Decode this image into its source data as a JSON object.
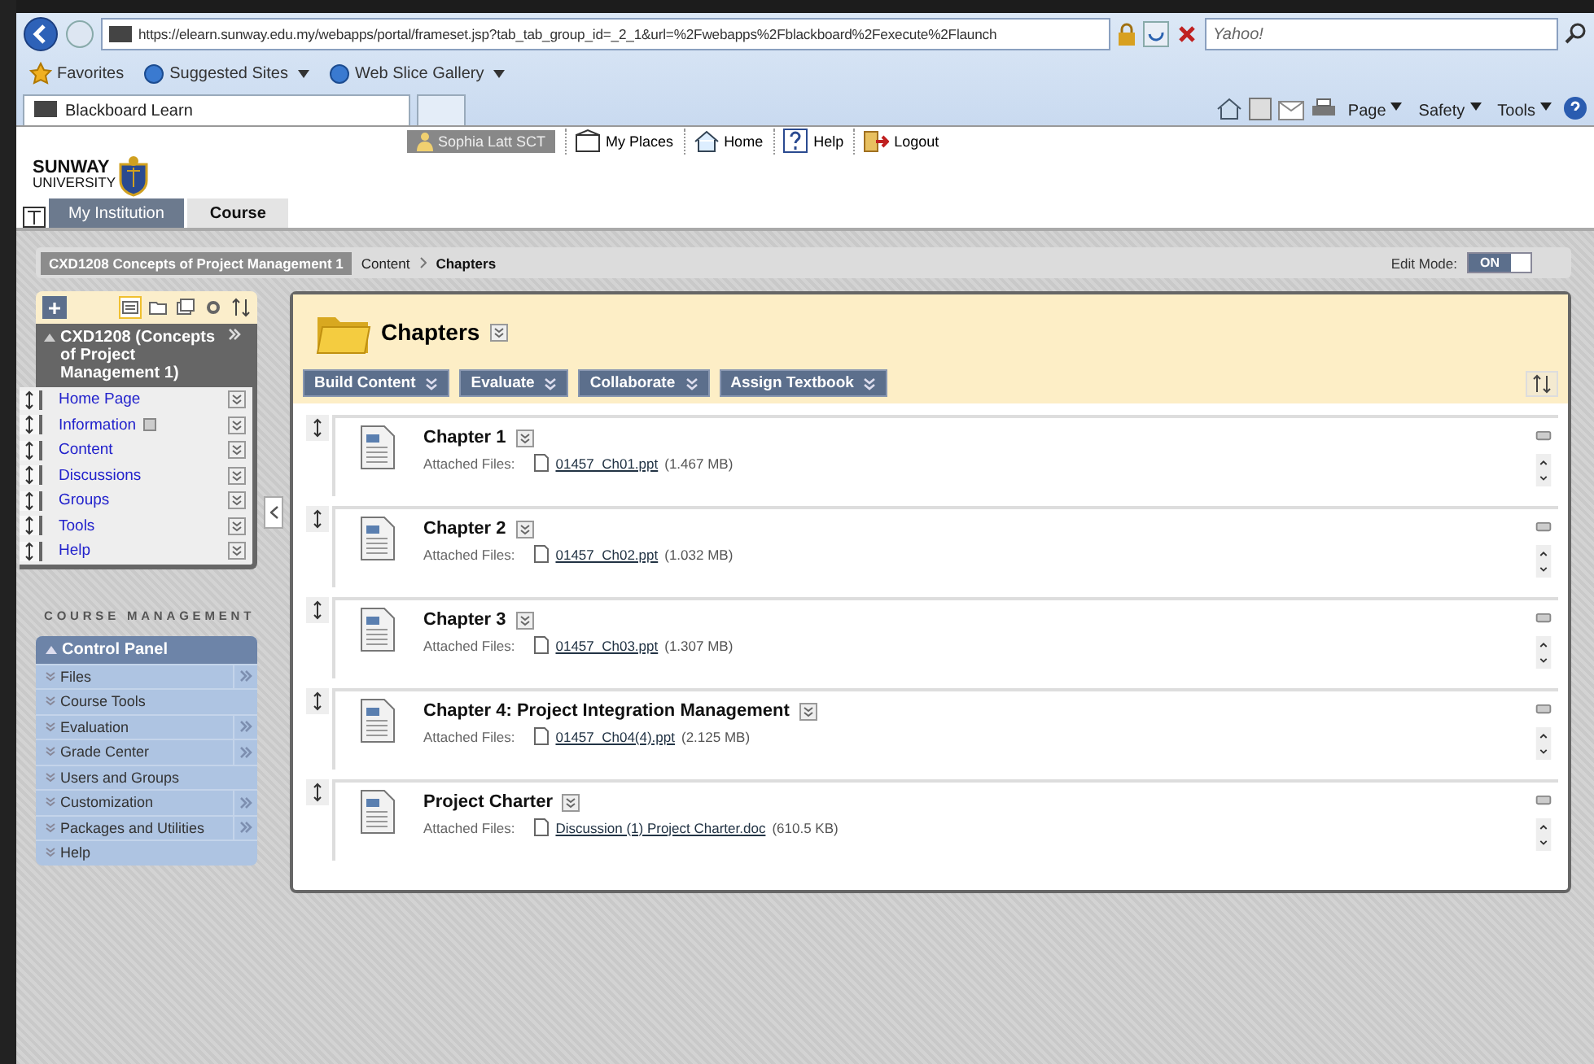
{
  "browser": {
    "url": "https://elearn.sunway.edu.my/webapps/portal/frameset.jsp?tab_tab_group_id=_2_1&url=%2Fwebapps%2Fblackboard%2Fexecute%2Flaunch",
    "search_placeholder": "Yahoo!",
    "favorites_label": "Favorites",
    "favorites": [
      "Suggested Sites",
      "Web Slice Gallery"
    ],
    "tab_title": "Blackboard Learn",
    "commands": [
      "Page",
      "Safety",
      "Tools"
    ]
  },
  "top_nav": {
    "user": "Sophia Latt SCT",
    "links": [
      "My Places",
      "Home",
      "Help",
      "Logout"
    ]
  },
  "logo": {
    "line1": "SUNWAY",
    "line2": "UNIVERSITY"
  },
  "tabs": [
    {
      "label": "My Institution",
      "selected": false
    },
    {
      "label": "Course",
      "selected": true
    }
  ],
  "breadcrumb": {
    "course": "CXD1208 Concepts of Project Management 1",
    "items": [
      "Content",
      "Chapters"
    ]
  },
  "edit_mode": {
    "label": "Edit Mode:",
    "value": "ON",
    "on": true
  },
  "course_menu": {
    "title": "CXD1208 (Concepts of Project Management 1)",
    "items": [
      {
        "label": "Home Page",
        "info": false
      },
      {
        "label": "Information",
        "info": true
      },
      {
        "label": "Content",
        "info": false
      },
      {
        "label": "Discussions",
        "info": false
      },
      {
        "label": "Groups",
        "info": false
      },
      {
        "label": "Tools",
        "info": false
      },
      {
        "label": "Help",
        "info": false
      }
    ]
  },
  "course_management": {
    "heading": "COURSE MANAGEMENT",
    "panel_title": "Control Panel",
    "items": [
      {
        "label": "Files",
        "submenu": true
      },
      {
        "label": "Course Tools",
        "submenu": false
      },
      {
        "label": "Evaluation",
        "submenu": true
      },
      {
        "label": "Grade Center",
        "submenu": true
      },
      {
        "label": "Users and Groups",
        "submenu": false
      },
      {
        "label": "Customization",
        "submenu": true
      },
      {
        "label": "Packages and Utilities",
        "submenu": true
      },
      {
        "label": "Help",
        "submenu": false
      }
    ]
  },
  "content": {
    "title": "Chapters",
    "buttons": [
      "Build Content",
      "Evaluate",
      "Collaborate",
      "Assign Textbook"
    ],
    "items": [
      {
        "title": "Chapter 1",
        "files_label": "Attached Files:",
        "file": "01457_Ch01.ppt",
        "size": "(1.467 MB)"
      },
      {
        "title": "Chapter 2",
        "files_label": "Attached Files:",
        "file": "01457_Ch02.ppt",
        "size": "(1.032 MB)"
      },
      {
        "title": "Chapter 3",
        "files_label": "Attached Files:",
        "file": "01457_Ch03.ppt",
        "size": "(1.307 MB)"
      },
      {
        "title": "Chapter 4: Project Integration Management",
        "files_label": "Attached Files:",
        "file": "01457_Ch04(4).ppt",
        "size": "(2.125 MB)"
      },
      {
        "title": "Project Charter",
        "files_label": "Attached Files:",
        "file": "Discussion (1) Project Charter.doc",
        "size": "(610.5 KB)"
      }
    ]
  }
}
